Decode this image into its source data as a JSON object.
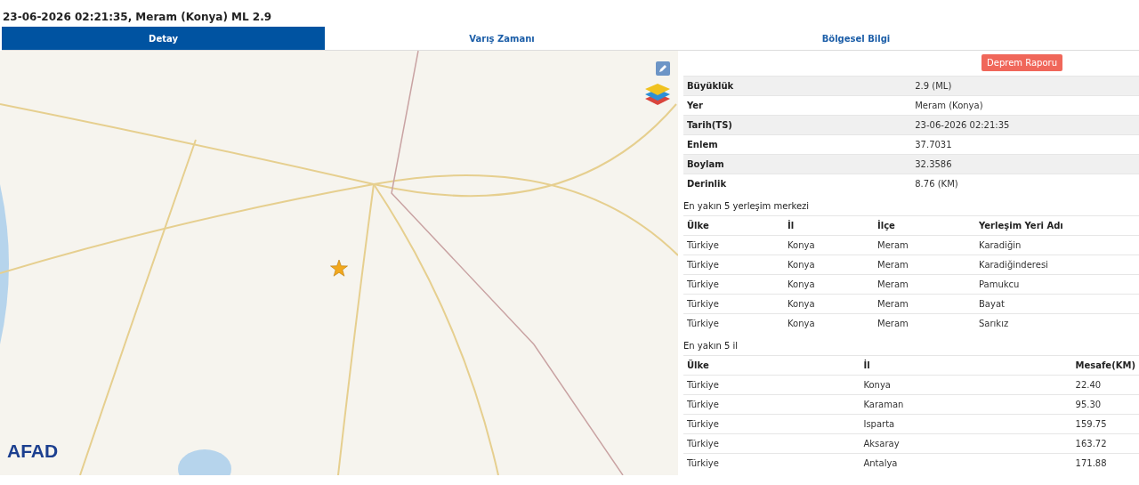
{
  "title": "23-06-2026 02:21:35, Meram (Konya) ML 2.9",
  "tabs": [
    {
      "label": "Detay",
      "selected": true
    },
    {
      "label": "Varış Zamanı",
      "selected": false
    },
    {
      "label": "Bölgesel Bilgi",
      "selected": false
    }
  ],
  "map": {
    "logo": "AFAD"
  },
  "report_button": "Deprem Raporu",
  "details": [
    {
      "label": "Büyüklük",
      "value": "2.9 (ML)"
    },
    {
      "label": "Yer",
      "value": "Meram (Konya)"
    },
    {
      "label": "Tarih(TS)",
      "value": "23-06-2026 02:21:35"
    },
    {
      "label": "Enlem",
      "value": "37.7031"
    },
    {
      "label": "Boylam",
      "value": "32.3586"
    },
    {
      "label": "Derinlik",
      "value": "8.76 (KM)"
    }
  ],
  "settlements": {
    "heading": "En yakın 5 yerleşim merkezi",
    "columns": [
      "Ülke",
      "İl",
      "İlçe",
      "Yerleşim Yeri Adı"
    ],
    "rows": [
      [
        "Türkiye",
        "Konya",
        "Meram",
        "Karadiğin"
      ],
      [
        "Türkiye",
        "Konya",
        "Meram",
        "Karadiğinderesi"
      ],
      [
        "Türkiye",
        "Konya",
        "Meram",
        "Pamukcu"
      ],
      [
        "Türkiye",
        "Konya",
        "Meram",
        "Bayat"
      ],
      [
        "Türkiye",
        "Konya",
        "Meram",
        "Sarıkız"
      ]
    ]
  },
  "provinces": {
    "heading": "En yakın 5 il",
    "columns": [
      "Ülke",
      "İl",
      "Mesafe(KM)"
    ],
    "rows": [
      [
        "Türkiye",
        "Konya",
        "22.40"
      ],
      [
        "Türkiye",
        "Karaman",
        "95.30"
      ],
      [
        "Türkiye",
        "Isparta",
        "159.75"
      ],
      [
        "Türkiye",
        "Aksaray",
        "163.72"
      ],
      [
        "Türkiye",
        "Antalya",
        "171.88"
      ]
    ]
  }
}
